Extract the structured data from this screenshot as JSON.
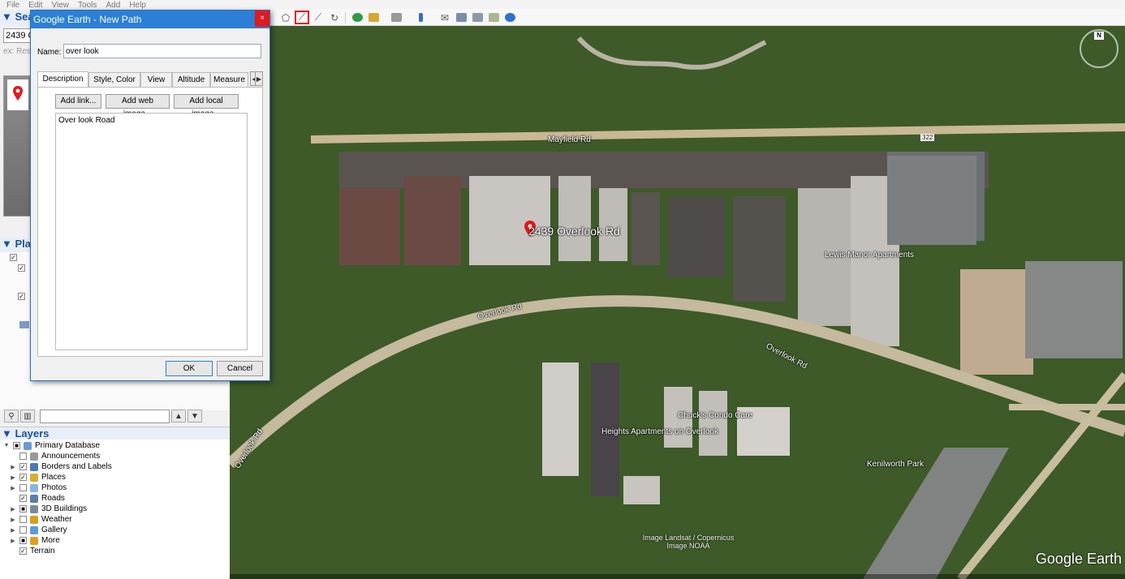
{
  "menu": [
    "File",
    "Edit",
    "View",
    "Tools",
    "Add",
    "Help"
  ],
  "left_panel": {
    "search_header": "Sear",
    "search_value": "2439 O",
    "search_hint": "ex: Rest",
    "places_header": "Plac",
    "layers_header": "Layers",
    "layers": [
      {
        "label": "Primary Database",
        "checked": "■",
        "expand": "▼",
        "icon": "database-icon",
        "color": "#6a9ad8"
      },
      {
        "label": "Announcements",
        "checked": "",
        "expand": "",
        "icon": "envelope-icon",
        "color": "#999999"
      },
      {
        "label": "Borders and Labels",
        "checked": "✓",
        "expand": "▶",
        "icon": "flag-icon",
        "color": "#4a7ab0"
      },
      {
        "label": "Places",
        "checked": "✓",
        "expand": "▶",
        "icon": "places-icon",
        "color": "#d4b02c"
      },
      {
        "label": "Photos",
        "checked": "",
        "expand": "▶",
        "icon": "photo-icon",
        "color": "#8ab4e0"
      },
      {
        "label": "Roads",
        "checked": "✓",
        "expand": "",
        "icon": "roads-icon",
        "color": "#5a7ea8"
      },
      {
        "label": "3D Buildings",
        "checked": "■",
        "expand": "▶",
        "icon": "building-icon",
        "color": "#7a8a9a"
      },
      {
        "label": "Weather",
        "checked": "",
        "expand": "▶",
        "icon": "weather-icon",
        "color": "#d4a020"
      },
      {
        "label": "Gallery",
        "checked": "",
        "expand": "▶",
        "icon": "gallery-icon",
        "color": "#5a9ad8"
      },
      {
        "label": "More",
        "checked": "■",
        "expand": "▶",
        "icon": "more-icon",
        "color": "#e0a020"
      },
      {
        "label": "Terrain",
        "checked": "✓",
        "expand": "",
        "icon": "",
        "color": ""
      }
    ]
  },
  "dialog": {
    "title": "Google Earth - New Path",
    "close": "×",
    "name_label": "Name:",
    "name_value": "over look",
    "tabs": [
      "Description",
      "Style, Color",
      "View",
      "Altitude",
      "Measure"
    ],
    "add_link": "Add link...",
    "add_web_image": "Add web image...",
    "add_local_image": "Add local image...",
    "description": "Over look Road",
    "ok": "OK",
    "cancel": "Cancel"
  },
  "map": {
    "labels": {
      "mayfield": "Mayfield Rd",
      "placemark": "2439 Overlook Rd",
      "lewis": "Lewis Manor Apartments",
      "overlook1": "Overlook Rd",
      "overlook2": "Overlook Rd",
      "overlook3": "Overlook Rd",
      "chuck": "Chuck's Condo Care",
      "heights": "Heights Apartments on Overlook",
      "kenilworth": "Kenilworth Park",
      "route": "322",
      "compass_n": "N"
    },
    "attribution": [
      "Image Landsat / Copernicus",
      "Image NOAA"
    ],
    "watermark": "Google Earth"
  },
  "colors": {
    "title_bar": "#2b7fd6",
    "close_button": "#e0191e",
    "toolbar_highlight": "#e0191e",
    "panel_header_text": "#1c4f9c"
  }
}
